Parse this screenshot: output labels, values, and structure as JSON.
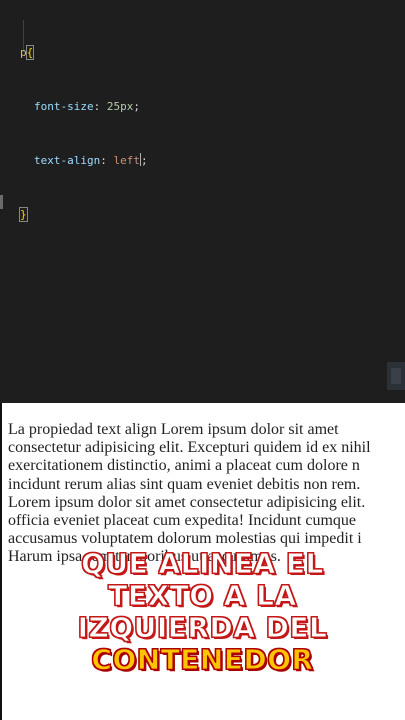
{
  "editor": {
    "lines": [
      {
        "selector": "p",
        "open_brace": "{"
      },
      {
        "property": "font-size",
        "colon": ":",
        "value_number": "25px",
        "semicolon": ";"
      },
      {
        "property": "text-align",
        "colon": ":",
        "value_keyword": "left",
        "semicolon": ";"
      },
      {
        "close_brace": "}"
      }
    ]
  },
  "preview": {
    "paragraph": "La propiedad text align Lorem ipsum dolor sit amet\nconsectetur adipisicing elit. Excepturi quidem id ex nihil\nexercitationem distinctio, animi a placeat cum dolore n\nincidunt rerum alias sint quam eveniet debitis non rem.\nLorem ipsum dolor sit amet consectetur adipisicing elit.\nofficia eveniet placeat cum expedita! Incidunt cumque\naccusamus voluptatem dolorum molestias qui impedit i\nHarum ipsa rem temporibus ut accusamus."
  },
  "caption": {
    "line1": "QUE ALINEA EL",
    "line2": "TEXTO A LA",
    "line3": "IZQUIERDA DEL",
    "line4": "CONTENEDOR"
  },
  "colors": {
    "editor_bg": "#1e1e1e",
    "selector": "#d7ba7d",
    "property": "#9cdcfe",
    "number": "#b5cea8",
    "string_value": "#ce9178",
    "caption_red": "#c41818",
    "caption_gold": "#ffc400"
  }
}
